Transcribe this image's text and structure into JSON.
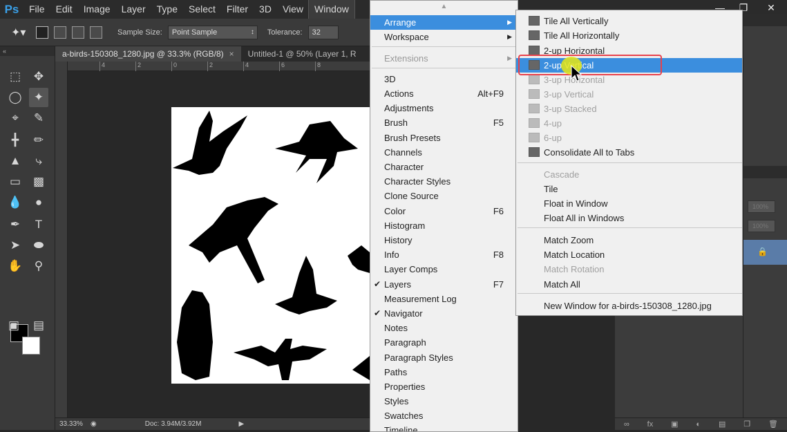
{
  "app": {
    "logo": "Ps",
    "menu": [
      "File",
      "Edit",
      "Image",
      "Layer",
      "Type",
      "Select",
      "Filter",
      "3D",
      "View",
      "Window"
    ],
    "active_menu": "Window",
    "window_controls": [
      "—",
      "❐",
      "✕"
    ]
  },
  "options_bar": {
    "sample_size_label": "Sample Size:",
    "sample_size_value": "Point Sample",
    "tolerance_label": "Tolerance:",
    "tolerance_value": "32"
  },
  "document_tabs": [
    {
      "title": "a-birds-150308_1280.jpg @ 33.3% (RGB/8)",
      "close": "×",
      "active": true
    },
    {
      "title": "Untitled-1 @ 50% (Layer 1, R",
      "close": "",
      "active": false
    }
  ],
  "ruler_ticks": [
    "4",
    "2",
    "0",
    "2",
    "4",
    "6",
    "8"
  ],
  "status_bar": {
    "zoom": "33.33%",
    "doc_info": "Doc: 3.94M/3.92M"
  },
  "window_menu": {
    "items": [
      {
        "label": "Arrange",
        "highlighted": true,
        "submenu": true
      },
      {
        "label": "Workspace",
        "submenu": true
      },
      {
        "sep": true
      },
      {
        "label": "Extensions",
        "disabled": true,
        "submenu": true
      },
      {
        "sep": true
      },
      {
        "label": "3D"
      },
      {
        "label": "Actions",
        "shortcut": "Alt+F9"
      },
      {
        "label": "Adjustments"
      },
      {
        "label": "Brush",
        "shortcut": "F5"
      },
      {
        "label": "Brush Presets"
      },
      {
        "label": "Channels"
      },
      {
        "label": "Character"
      },
      {
        "label": "Character Styles"
      },
      {
        "label": "Clone Source"
      },
      {
        "label": "Color",
        "shortcut": "F6"
      },
      {
        "label": "Histogram"
      },
      {
        "label": "History"
      },
      {
        "label": "Info",
        "shortcut": "F8"
      },
      {
        "label": "Layer Comps"
      },
      {
        "label": "Layers",
        "shortcut": "F7",
        "checked": true
      },
      {
        "label": "Measurement Log"
      },
      {
        "label": "Navigator",
        "checked": true
      },
      {
        "label": "Notes"
      },
      {
        "label": "Paragraph"
      },
      {
        "label": "Paragraph Styles"
      },
      {
        "label": "Paths"
      },
      {
        "label": "Properties"
      },
      {
        "label": "Styles"
      },
      {
        "label": "Swatches"
      },
      {
        "label": "Timeline"
      }
    ]
  },
  "arrange_menu": {
    "items": [
      {
        "label": "Tile All Vertically",
        "icon": "tile-vertical-icon"
      },
      {
        "label": "Tile All Horizontally",
        "icon": "tile-horizontal-icon"
      },
      {
        "label": "2-up Horizontal",
        "icon": "two-up-horizontal-icon"
      },
      {
        "label": "2-up Vertical",
        "icon": "two-up-vertical-icon",
        "highlighted": true
      },
      {
        "label": "3-up Horizontal",
        "icon": "three-up-horizontal-icon",
        "disabled": true
      },
      {
        "label": "3-up Vertical",
        "icon": "three-up-vertical-icon",
        "disabled": true
      },
      {
        "label": "3-up Stacked",
        "icon": "three-up-stacked-icon",
        "disabled": true
      },
      {
        "label": "4-up",
        "icon": "four-up-icon",
        "disabled": true
      },
      {
        "label": "6-up",
        "icon": "six-up-icon",
        "disabled": true
      },
      {
        "label": "Consolidate All to Tabs",
        "icon": "consolidate-tabs-icon"
      },
      {
        "sep": true
      },
      {
        "label": "Cascade",
        "disabled": true
      },
      {
        "label": "Tile"
      },
      {
        "label": "Float in Window"
      },
      {
        "label": "Float All in Windows"
      },
      {
        "sep": true
      },
      {
        "label": "Match Zoom"
      },
      {
        "label": "Match Location"
      },
      {
        "label": "Match Rotation",
        "disabled": true
      },
      {
        "label": "Match All"
      },
      {
        "sep": true
      },
      {
        "label": "New Window for a-birds-150308_1280.jpg"
      }
    ]
  },
  "right_panel": {
    "opacity_value": "100%",
    "fill_value": "100%"
  },
  "colors": {
    "highlight": "#3b8ede",
    "annotation_ring": "#e8414b",
    "cursor_halo": "#e6e614"
  }
}
